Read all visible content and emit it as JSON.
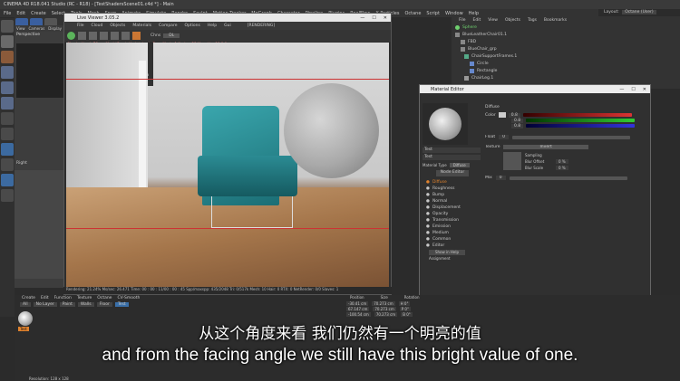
{
  "app": {
    "title": "CINEMA 4D R18.041 Studio (RC - R18) - [TestShadersScene01.c4d *] - Main",
    "menu": [
      "File",
      "Edit",
      "Create",
      "Select",
      "Tools",
      "Mesh",
      "Snap",
      "Animate",
      "Simulate",
      "Render",
      "Sculpt",
      "Motion Tracker",
      "MoGraph",
      "Character",
      "Pipeline",
      "Plugins",
      "RealFlow",
      "X-Particles",
      "Octane",
      "Script",
      "Window",
      "Help"
    ],
    "layout_label": "Layout:",
    "layout_value": "Octane (User)"
  },
  "left_viewport": {
    "menu": [
      "View",
      "Cameras",
      "Display"
    ],
    "label": "Perspective",
    "lower_label": "Right"
  },
  "live_viewer": {
    "title": "Live Viewer 3.05.2",
    "menu": [
      "File",
      "Cloud",
      "Objects",
      "Materials",
      "Compare",
      "Options",
      "Help",
      "Gui"
    ],
    "rendering_label": "[RENDERING]",
    "channel_label": "Chns",
    "channel_value": "DL",
    "status_line": "Checked(ms): 76ms. Mesh(Gen.): Update(ms): 7ms, Mesh: 1 Nodes: 25 Movable: 18 0:0",
    "gpu_stats": [
      {
        "name": "GTX 980 Ti(T)[5.2]",
        "load": "%97",
        "temp": "39°C"
      },
      {
        "name": "GTX 980 Ti(T)[5.2]",
        "load": "%97",
        "temp": "35°C"
      },
      {
        "name": "GTX 980 Ti(T)[5.2]",
        "load": "%98",
        "temp": "35°C"
      },
      {
        "name": "GTX 980 Ti(T)[5.2]",
        "load": "%98",
        "temp": "37°C"
      }
    ],
    "mem_lines": [
      "Out of core used/max:0Kb/4Gb",
      "Grey8/16: 0/1      Rgb32/64: 0/3",
      "Used/free/total vram: 1.691Gb/3.927Gb/6Gb"
    ],
    "render_stats": "Rendering: 21.24%   Ms/sec: 26.471   Time: 00 : 00 : 11/00 : 00 : 45   Spp/maxspp: 435/2048   Tri: 0/517k   Mesh: 10   Hair: 0   RTX: 0   NetRender: 0/0   Slaves: 1"
  },
  "object_manager": {
    "menu": [
      "File",
      "Edit",
      "View",
      "Objects",
      "Tags",
      "Bookmarks"
    ],
    "items": [
      "Sphere",
      "BlueLeatherChair01.1",
      "FBD",
      "BlueChair_grp",
      "ChairSupportFrames.1",
      "Circle",
      "Rectangle",
      "ChairLeg.1"
    ]
  },
  "material_editor": {
    "title": "Material Editor",
    "section": "Diffuse",
    "color_label": "Color",
    "color_values": [
      "0.8",
      "0.8",
      "0.8"
    ],
    "float_label": "Float",
    "float_value": "0",
    "texture_label": "Texture",
    "texture_value": "Invert",
    "sampling_label": "Sampling",
    "blur_offset_label": "Blur Offset",
    "blur_offset_value": "0 %",
    "blur_scale_label": "Blur Scale",
    "blur_scale_value": "0 %",
    "mix_label": "Mix",
    "mix_value": "0",
    "mat_name": "Test",
    "mat_type_label": "Material Type",
    "mat_type_value": "Diffuse",
    "node_editor_btn": "Node Editor",
    "channels": [
      "Diffuse",
      "Roughness",
      "Bump",
      "Normal",
      "Displacement",
      "Opacity",
      "Transmission",
      "Emission",
      "Medium",
      "Common",
      "Editor"
    ],
    "show_in_help": "Show in Help",
    "assignment": "Assignment"
  },
  "bottom_panel": {
    "mat_tabs_menu": [
      "Create",
      "Edit",
      "Function",
      "Texture",
      "Octane",
      "CV-Smooth"
    ],
    "mat_filters": [
      "All",
      "No Layer",
      "Paint",
      "Walls",
      "Floor",
      "Test"
    ],
    "coords_header": [
      "Position",
      "Size",
      "Rotation"
    ],
    "coords": [
      {
        "p": "-30.41 cm",
        "s": "70.273 cm",
        "r": "H 0°"
      },
      {
        "p": "67.147 cm",
        "s": "70.273 cm",
        "r": "P 0°"
      },
      {
        "p": "-100.54 cm",
        "s": "70.273 cm",
        "r": "B 0°"
      }
    ],
    "status": "Resolution: 128 x 128",
    "material_thumb_label": "Test"
  },
  "subtitles": {
    "zh": "从这个角度来看 我们仍然有一个明亮的值",
    "en": "and from the facing angle we still have this bright value of one."
  },
  "colors": {
    "accent_orange": "#e0822d",
    "selected_green": "#6fd16f",
    "highlight_yellow": "#ffcc33"
  }
}
